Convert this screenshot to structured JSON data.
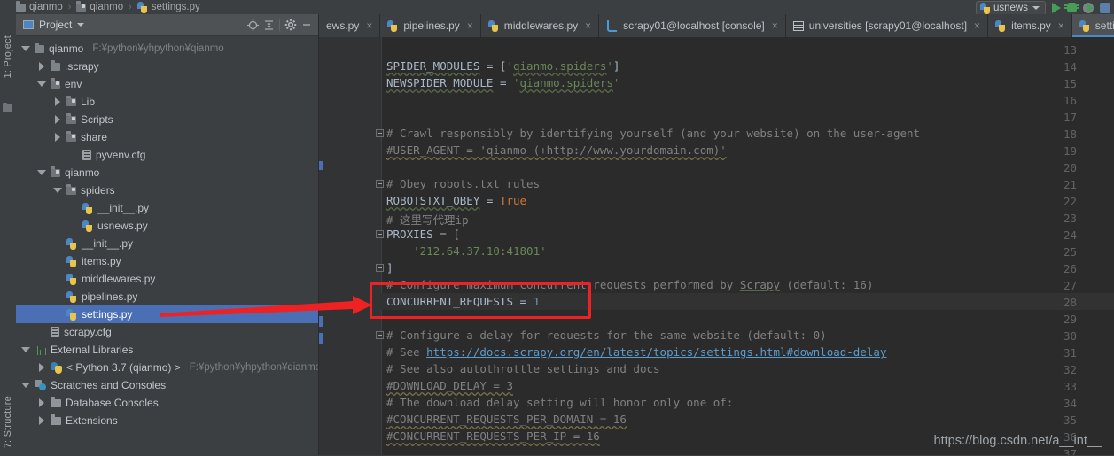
{
  "breadcrumb": {
    "items": [
      {
        "label": "qianmo",
        "icon": "folder-icon"
      },
      {
        "label": "qianmo",
        "icon": "module-folder-icon"
      },
      {
        "label": "settings.py",
        "icon": "python-file-icon"
      }
    ],
    "separator": "›"
  },
  "run_toolbar": {
    "config_name": "usnews",
    "config_icon": "python-file-icon",
    "dropdown_icon": "chevron-down-icon",
    "run_icon": "run-icon",
    "debug_icon": "debug-icon",
    "coverage_icon": "run-with-coverage-icon",
    "stop_icon": "stop-icon"
  },
  "left_strip": {
    "top_label": "1: Project",
    "bottom_label": "7: Structure",
    "favorites_icon": "folder-icon"
  },
  "project_panel": {
    "title": "Project",
    "title_icon": "project-view-icon",
    "dropdown_icon": "chevron-down-icon",
    "toolbar": {
      "locate_icon": "locate-icon",
      "collapse_icon": "collapse-all-icon",
      "settings_icon": "gear-icon",
      "hide_icon": "minimize-icon"
    },
    "tree": [
      {
        "label": "qianmo",
        "path": "F:¥python¥yhpython¥qianmo",
        "indent": 0,
        "twisty": "down",
        "icon": "folder-icon",
        "selected": false
      },
      {
        "label": ".scrapy",
        "path": "",
        "indent": 1,
        "twisty": "right",
        "icon": "folder-icon",
        "selected": false
      },
      {
        "label": "env",
        "path": "",
        "indent": 1,
        "twisty": "down",
        "icon": "module-folder-icon",
        "selected": false
      },
      {
        "label": "Lib",
        "path": "",
        "indent": 2,
        "twisty": "right",
        "icon": "module-folder-icon",
        "selected": false
      },
      {
        "label": "Scripts",
        "path": "",
        "indent": 2,
        "twisty": "right",
        "icon": "module-folder-icon",
        "selected": false
      },
      {
        "label": "share",
        "path": "",
        "indent": 2,
        "twisty": "right",
        "icon": "module-folder-icon",
        "selected": false
      },
      {
        "label": "pyvenv.cfg",
        "path": "",
        "indent": 3,
        "twisty": "none",
        "icon": "config-file-icon",
        "selected": false
      },
      {
        "label": "qianmo",
        "path": "",
        "indent": 1,
        "twisty": "down",
        "icon": "module-folder-icon",
        "selected": false
      },
      {
        "label": "spiders",
        "path": "",
        "indent": 2,
        "twisty": "down",
        "icon": "module-folder-icon",
        "selected": false
      },
      {
        "label": "__init__.py",
        "path": "",
        "indent": 3,
        "twisty": "none",
        "icon": "python-file-icon",
        "selected": false
      },
      {
        "label": "usnews.py",
        "path": "",
        "indent": 3,
        "twisty": "none",
        "icon": "python-file-icon",
        "selected": false
      },
      {
        "label": "__init__.py",
        "path": "",
        "indent": 2,
        "twisty": "none",
        "icon": "python-file-icon",
        "selected": false
      },
      {
        "label": "items.py",
        "path": "",
        "indent": 2,
        "twisty": "none",
        "icon": "python-file-icon",
        "selected": false
      },
      {
        "label": "middlewares.py",
        "path": "",
        "indent": 2,
        "twisty": "none",
        "icon": "python-file-icon",
        "selected": false
      },
      {
        "label": "pipelines.py",
        "path": "",
        "indent": 2,
        "twisty": "none",
        "icon": "python-file-icon",
        "selected": false
      },
      {
        "label": "settings.py",
        "path": "",
        "indent": 2,
        "twisty": "none",
        "icon": "python-file-icon",
        "selected": true
      },
      {
        "label": "scrapy.cfg",
        "path": "",
        "indent": 1,
        "twisty": "none",
        "icon": "config-file-icon",
        "selected": false
      },
      {
        "label": "External Libraries",
        "path": "",
        "indent": 0,
        "twisty": "down",
        "icon": "libraries-icon",
        "selected": false
      },
      {
        "label": "< Python 3.7 (qianmo) >",
        "path": "F:¥python¥yhpython¥qianmo",
        "indent": 1,
        "twisty": "right",
        "icon": "python-sdk-icon",
        "selected": false
      },
      {
        "label": "Scratches and Consoles",
        "path": "",
        "indent": 0,
        "twisty": "down",
        "icon": "scratches-icon",
        "selected": false
      },
      {
        "label": "Database Consoles",
        "path": "",
        "indent": 1,
        "twisty": "right",
        "icon": "plain-folder-icon",
        "selected": false
      },
      {
        "label": "Extensions",
        "path": "",
        "indent": 1,
        "twisty": "right",
        "icon": "plain-folder-icon",
        "selected": false
      }
    ]
  },
  "editor": {
    "tabs": [
      {
        "label": "ews.py",
        "icon": "python-file-icon",
        "active": false,
        "truncated_left": true
      },
      {
        "label": "pipelines.py",
        "icon": "python-file-icon",
        "active": false
      },
      {
        "label": "middlewares.py",
        "icon": "python-file-icon",
        "active": false
      },
      {
        "label": "scrapy01@localhost [console]",
        "icon": "console-icon",
        "active": false
      },
      {
        "label": "universities [scrapy01@localhost]",
        "icon": "table-icon",
        "active": false
      },
      {
        "label": "items.py",
        "icon": "python-file-icon",
        "active": false
      },
      {
        "label": "settin",
        "icon": "python-file-icon",
        "active": true
      }
    ],
    "close_icon": "×",
    "first_line_number": 13,
    "lines": [
      {
        "n": 13,
        "text": "",
        "fold": ""
      },
      {
        "n": 14,
        "text": "SPIDER_MODULES = ['qianmo.spiders']",
        "fold": ""
      },
      {
        "n": 15,
        "text": "NEWSPIDER_MODULE = 'qianmo.spiders'",
        "fold": ""
      },
      {
        "n": 16,
        "text": "",
        "fold": ""
      },
      {
        "n": 17,
        "text": "",
        "fold": ""
      },
      {
        "n": 18,
        "text": "# Crawl responsibly by identifying yourself (and your website) on the user-agent",
        "fold": "open"
      },
      {
        "n": 19,
        "text": "#USER_AGENT = 'qianmo (+http://www.yourdomain.com)'",
        "fold": ""
      },
      {
        "n": 20,
        "text": "",
        "fold": ""
      },
      {
        "n": 21,
        "text": "# Obey robots.txt rules",
        "fold": "open"
      },
      {
        "n": 22,
        "text": "ROBOTSTXT_OBEY = True",
        "fold": ""
      },
      {
        "n": 23,
        "text": "# 这里写代理ip",
        "fold": ""
      },
      {
        "n": 24,
        "text": "PROXIES = [",
        "fold": "open"
      },
      {
        "n": 25,
        "text": "    '212.64.37.10:41801'",
        "fold": ""
      },
      {
        "n": 26,
        "text": "]",
        "fold": "close"
      },
      {
        "n": 27,
        "text": "# Configure maximum concurrent requests performed by Scrapy (default: 16)",
        "fold": ""
      },
      {
        "n": 28,
        "text": "CONCURRENT_REQUESTS = 1",
        "fold": "",
        "highlighted": true
      },
      {
        "n": 29,
        "text": "",
        "fold": ""
      },
      {
        "n": 30,
        "text": "# Configure a delay for requests for the same website (default: 0)",
        "fold": "open"
      },
      {
        "n": 31,
        "text": "# See https://docs.scrapy.org/en/latest/topics/settings.html#download-delay",
        "fold": ""
      },
      {
        "n": 32,
        "text": "# See also autothrottle settings and docs",
        "fold": ""
      },
      {
        "n": 33,
        "text": "#DOWNLOAD_DELAY = 3",
        "fold": ""
      },
      {
        "n": 34,
        "text": "# The download delay setting will honor only one of:",
        "fold": ""
      },
      {
        "n": 35,
        "text": "#CONCURRENT_REQUESTS_PER_DOMAIN = 16",
        "fold": ""
      },
      {
        "n": 36,
        "text": "#CONCURRENT_REQUESTS_PER_IP = 16",
        "fold": ""
      },
      {
        "n": 37,
        "text": "",
        "fold": ""
      }
    ]
  },
  "annotations": {
    "highlight_box_target": "CONCURRENT_REQUESTS = 1",
    "arrow_from": "settings.py",
    "arrow_color": "#ee2222",
    "box_color": "#ee2222"
  },
  "watermark": "https://blog.csdn.net/a__int__",
  "colors": {
    "accent": "#4a6fb5",
    "annotation": "#ee2222",
    "editor_bg": "#2b2b2b",
    "panel_bg": "#3c3f41"
  }
}
